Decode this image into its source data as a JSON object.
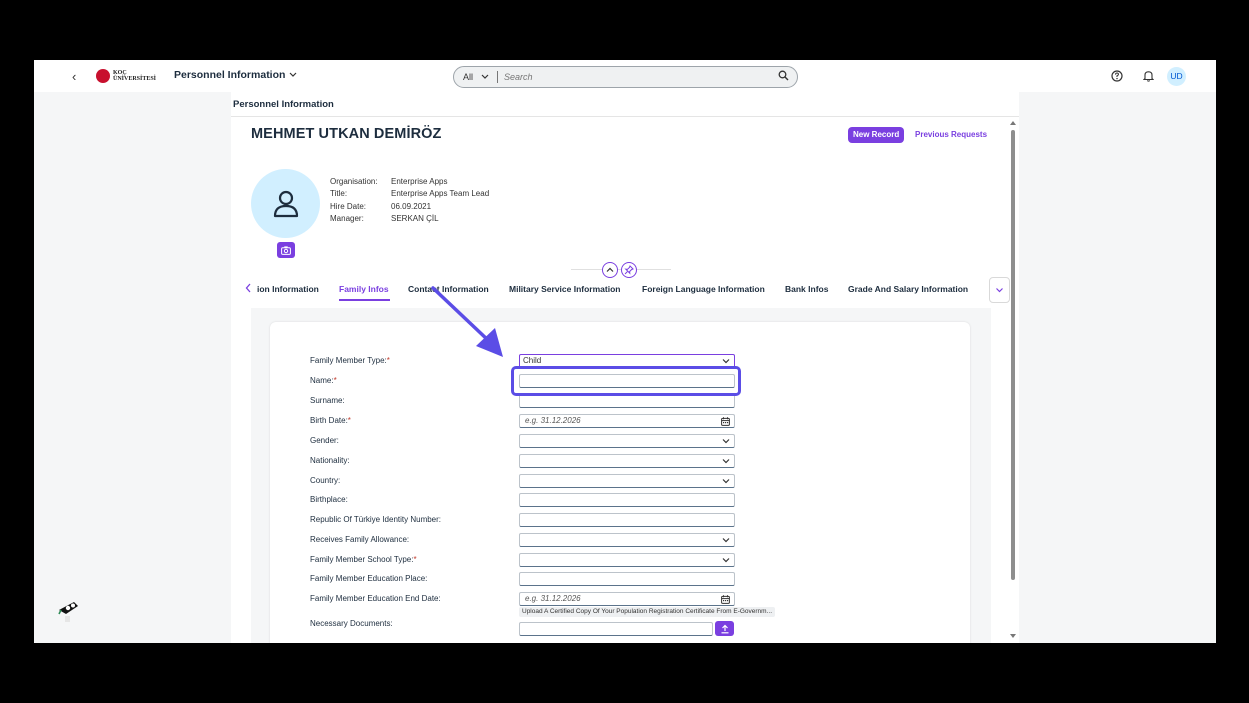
{
  "shell": {
    "logo_line1": "KOÇ",
    "logo_line2": "ÜNİVERSİTESİ",
    "app_title": "Personnel Information",
    "search_scope": "All",
    "search_placeholder": "Search",
    "avatar_initials": "UD"
  },
  "page": {
    "title": "Personnel Information",
    "employee_name": "MEHMET UTKAN DEMİRÖZ",
    "new_record_label": "New Record",
    "previous_requests_label": "Previous Requests",
    "attributes": [
      {
        "label": "Organisation:",
        "value": "Enterprise Apps"
      },
      {
        "label": "Title:",
        "value": "Enterprise Apps Team Lead"
      },
      {
        "label": "Hire Date:",
        "value": "06.09.2021"
      },
      {
        "label": "Manager:",
        "value": "SERKAN ÇİL"
      }
    ]
  },
  "tabs": [
    {
      "label": "ion Information",
      "active": false
    },
    {
      "label": "Family Infos",
      "active": true
    },
    {
      "label": "Contact Information",
      "active": false
    },
    {
      "label": "Military Service Information",
      "active": false
    },
    {
      "label": "Foreign Language Information",
      "active": false
    },
    {
      "label": "Bank Infos",
      "active": false
    },
    {
      "label": "Grade And Salary Information",
      "active": false
    }
  ],
  "form": {
    "fields": [
      {
        "label": "Family Member Type:",
        "required": true,
        "type": "select",
        "value": "Child"
      },
      {
        "label": "Name:",
        "required": true,
        "type": "input",
        "value": ""
      },
      {
        "label": "Surname:",
        "required": false,
        "type": "input",
        "value": ""
      },
      {
        "label": "Birth Date:",
        "required": true,
        "type": "date",
        "placeholder": "e.g. 31.12.2026"
      },
      {
        "label": "Gender:",
        "required": false,
        "type": "select",
        "value": ""
      },
      {
        "label": "Nationality:",
        "required": false,
        "type": "select",
        "value": ""
      },
      {
        "label": "Country:",
        "required": false,
        "type": "select",
        "value": ""
      },
      {
        "label": "Birthplace:",
        "required": false,
        "type": "input",
        "value": ""
      },
      {
        "label": "Republic Of Türkiye Identity Number:",
        "required": false,
        "type": "input",
        "value": ""
      },
      {
        "label": "Receives Family Allowance:",
        "required": false,
        "type": "select",
        "value": ""
      },
      {
        "label": "Family Member School Type:",
        "required": true,
        "type": "select",
        "value": ""
      },
      {
        "label": "Family Member Education Place:",
        "required": false,
        "type": "input",
        "value": ""
      },
      {
        "label": "Family Member Education End Date:",
        "required": false,
        "type": "date",
        "placeholder": "e.g. 31.12.2026"
      }
    ],
    "documents_label": "Necessary Documents:",
    "upload_hint": "Upload A Certified Copy Of Your Population Registration Certificate From E-Governm..."
  },
  "colors": {
    "accent": "#7a3fe0",
    "annotation": "#5b4de6"
  }
}
